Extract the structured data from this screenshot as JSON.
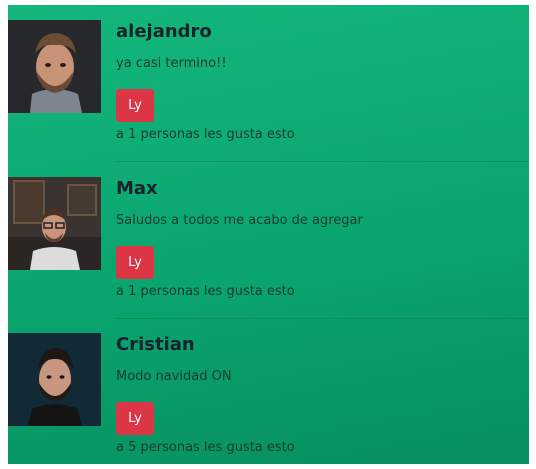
{
  "posts": [
    {
      "name": "alejandro",
      "message": "ya casi termino!!",
      "like_label": "Ly",
      "likes_text": "a 1 personas les gusta esto"
    },
    {
      "name": "Max",
      "message": "Saludos a todos me acabo de agregar",
      "like_label": "Ly",
      "likes_text": "a 1 personas les gusta esto"
    },
    {
      "name": "Cristian",
      "message": "Modo navidad ON",
      "like_label": "Ly",
      "likes_text": "a 5 personas les gusta esto"
    }
  ],
  "colors": {
    "panel": "#0aa56f",
    "like_button": "#dc3545",
    "name_text": "#18232b"
  }
}
